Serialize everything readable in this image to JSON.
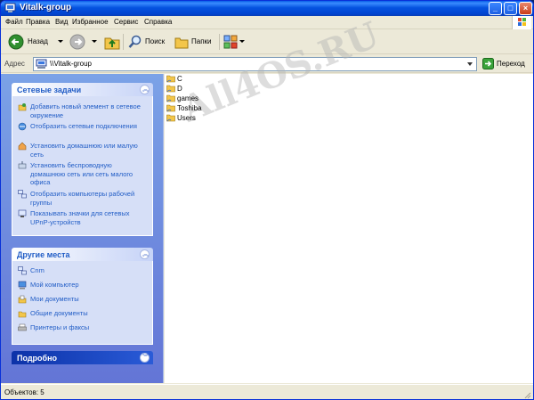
{
  "window": {
    "title": "Vitalk-group"
  },
  "titlebar_buttons": {
    "minimize": "_",
    "maximize": "□",
    "close": "×"
  },
  "menu": [
    "Файл",
    "Правка",
    "Вид",
    "Избранное",
    "Сервис",
    "Справка"
  ],
  "toolbar": {
    "back_label": "Назад",
    "search_label": "Поиск",
    "folders_label": "Папки"
  },
  "address": {
    "label": "Адрес",
    "value": "\\\\Vitalk-group",
    "go_label": "Переход"
  },
  "network_tasks": {
    "title": "Сетевые задачи",
    "items": [
      {
        "label": "Добавить новый элемент в сетевое окружение",
        "icon": "add-network-place-icon"
      },
      {
        "label": "Отобразить сетевые подключения",
        "icon": "network-connections-icon"
      },
      {
        "label": "Установить домашнюю или малую сеть",
        "icon": "home-network-icon"
      },
      {
        "label": "Установить беспроводную домашнюю сеть или сеть малого офиса",
        "icon": "wireless-network-icon"
      },
      {
        "label": "Отобразить компьютеры рабочей группы",
        "icon": "workgroup-computers-icon"
      },
      {
        "label": "Показывать значки для сетевых UPnP-устройств",
        "icon": "upnp-device-icon"
      }
    ]
  },
  "other_places": {
    "title": "Другие места",
    "items": [
      {
        "label": "Cnm",
        "icon": "network-icon"
      },
      {
        "label": "Мой компьютер",
        "icon": "my-computer-icon"
      },
      {
        "label": "Мои документы",
        "icon": "my-documents-icon"
      },
      {
        "label": "Общие документы",
        "icon": "shared-documents-icon"
      },
      {
        "label": "Принтеры и факсы",
        "icon": "printers-icon"
      }
    ]
  },
  "details": {
    "title": "Подробно"
  },
  "files": [
    "C",
    "D",
    "games",
    "Toshiba",
    "Users"
  ],
  "watermark": "All4OS.RU",
  "status": {
    "text": "Объектов: 5"
  },
  "colors": {
    "titlebar": "#0553e0",
    "panel_gradient_top": "#7ba2e7",
    "panel_gradient_bottom": "#6375d6",
    "link": "#215dc6",
    "folder": "#f5c542"
  }
}
